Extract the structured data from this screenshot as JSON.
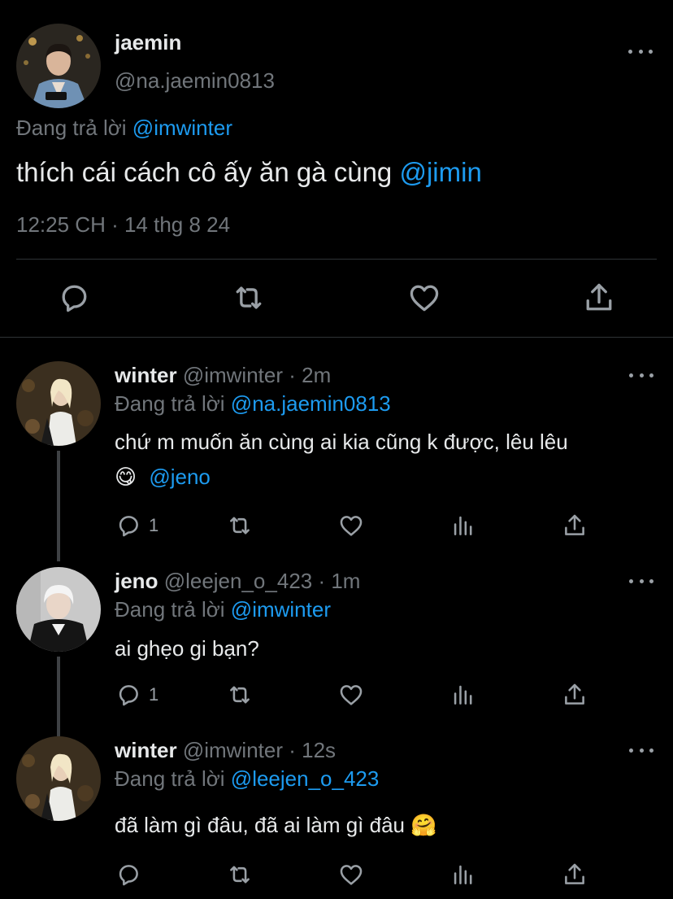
{
  "main_tweet": {
    "name": "jaemin",
    "handle": "@na.jaemin0813",
    "replying_prefix": "Đang trả lời",
    "replying_to": "@imwinter",
    "text": "thích cái cách cô ấy ăn gà cùng",
    "mention": "@jimin",
    "timestamp": "12:25 CH · 14 thg 8 24"
  },
  "replies": [
    {
      "name": "winter",
      "handle": "@imwinter",
      "time": "· 2m",
      "replying_prefix": "Đang trả lời",
      "replying_to": "@na.jaemin0813",
      "text": "chứ m muốn ăn cùng ai kia cũng k được, lêu lêu",
      "text_line2_emoji": "😋",
      "text_line2_mention": "@jeno",
      "reply_count": "1"
    },
    {
      "name": "jeno",
      "handle": "@leejen_o_423",
      "time": "· 1m",
      "replying_prefix": "Đang trả lời",
      "replying_to": "@imwinter",
      "text": "ai ghẹo gi bạn?",
      "reply_count": "1"
    },
    {
      "name": "winter",
      "handle": "@imwinter",
      "time": "· 12s",
      "replying_prefix": "Đang trả lời",
      "replying_to": "@leejen_o_423",
      "text": "đã làm gì đâu, đã ai làm gì đâu",
      "text_emoji": "🤗",
      "reply_count": ""
    }
  ],
  "icons": [
    "more-icon",
    "reply-icon",
    "retweet-icon",
    "like-icon",
    "views-icon",
    "share-icon"
  ],
  "colors": {
    "background": "#000000",
    "text": "#e7e9ea",
    "muted": "#71767b",
    "link": "#1d9bf0",
    "divider": "#2f3336"
  }
}
